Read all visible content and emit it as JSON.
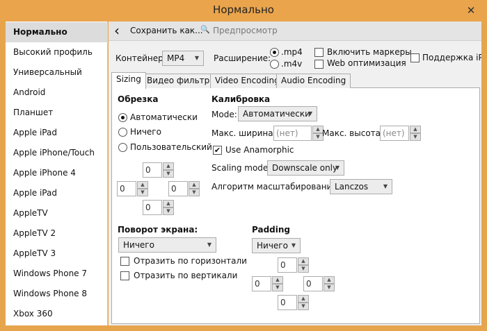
{
  "window": {
    "title": "Нормально",
    "close_glyph": "✕"
  },
  "sidebar": {
    "items": [
      {
        "label": "Нормально",
        "selected": true
      },
      {
        "label": "Высокий профиль"
      },
      {
        "label": "Универсальный"
      },
      {
        "label": "Android"
      },
      {
        "label": "Планшет"
      },
      {
        "label": "Apple iPad"
      },
      {
        "label": "Apple iPhone/Touch"
      },
      {
        "label": "Apple iPhone 4"
      },
      {
        "label": "Apple iPad"
      },
      {
        "label": "AppleTV"
      },
      {
        "label": "AppleTV 2"
      },
      {
        "label": "AppleTV 3"
      },
      {
        "label": "Windows Phone 7"
      },
      {
        "label": "Windows Phone 8"
      },
      {
        "label": "Xbox 360"
      }
    ]
  },
  "toolbar": {
    "back_icon": "‹",
    "save_label": "Сохранить как...",
    "preview_label": "Предпросмотр"
  },
  "container": {
    "label": "Контейнер:",
    "value": "MP4",
    "extension_label": "Расширение:",
    "ext_mp4": ".mp4",
    "ext_m4v": ".m4v",
    "markers_label": "Включить маркеры",
    "web_opt_label": "Web оптимизация",
    "ipod_label": "Поддержка iPod"
  },
  "tabs": [
    "Sizing",
    "Видео фильтры",
    "Video Encoding",
    "Audio Encoding"
  ],
  "crop": {
    "title": "Обрезка",
    "auto": "Автоматически",
    "none": "Ничего",
    "custom": "Пользовательский",
    "top": "0",
    "left": "0",
    "right": "0",
    "bottom": "0"
  },
  "calibration": {
    "title": "Калибровка",
    "mode_label": "Mode:",
    "mode_value": "Автоматически",
    "max_width_label": "Макс. ширина:",
    "max_width_placeholder": "(нет)",
    "max_height_label": "Макс. высота:",
    "max_height_placeholder": "(нет)",
    "anamorphic_label": "Use Anamorphic",
    "scaling_label": "Scaling mode:",
    "scaling_value": "Downscale only",
    "algorithm_label": "Алгоритм масштабирования:",
    "algorithm_value": "Lanczos"
  },
  "rotation": {
    "title": "Поворот экрана:",
    "value": "Ничего",
    "flip_h": "Отразить по горизонтали",
    "flip_v": "Отразить по вертикали"
  },
  "padding": {
    "title": "Padding",
    "value": "Ничего",
    "top": "0",
    "left": "0",
    "right": "0",
    "bottom": "0"
  },
  "glyphs": {
    "check": "✔",
    "up": "▲",
    "down": "▼",
    "combo_arrow": "▼",
    "preview_icon": "🔍"
  }
}
